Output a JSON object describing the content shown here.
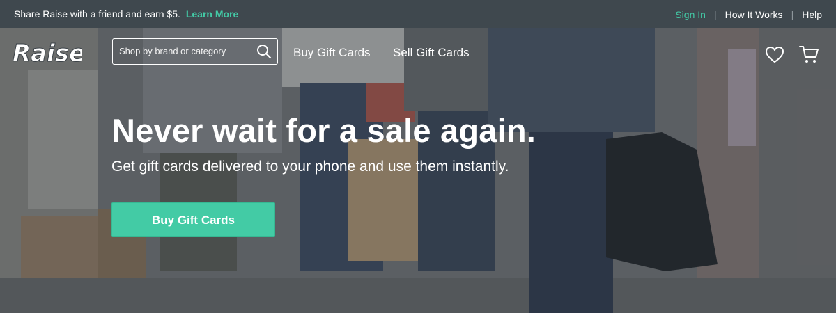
{
  "topbar": {
    "promo_text": "Share Raise with a friend and earn $5.",
    "promo_link": "Learn More",
    "sign_in": "Sign In",
    "how_it_works": "How It Works",
    "help": "Help"
  },
  "header": {
    "logo_text": "Raise",
    "search_placeholder": "Shop by brand or category",
    "nav_buy": "Buy Gift Cards",
    "nav_sell": "Sell Gift Cards"
  },
  "hero": {
    "headline": "Never wait for a sale again.",
    "subhead": "Get gift cards delivered to your phone and use them instantly.",
    "cta": "Buy Gift Cards"
  },
  "colors": {
    "accent": "#43c9a5",
    "topbar_bg": "#3f484e"
  },
  "icons": [
    "search-icon",
    "heart-icon",
    "cart-icon"
  ]
}
